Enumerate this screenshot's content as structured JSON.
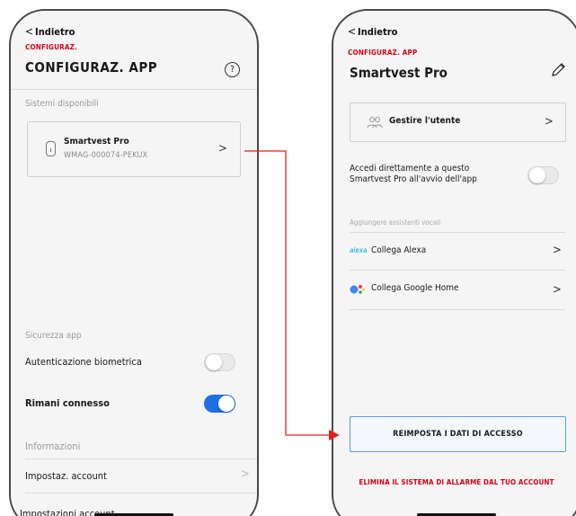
{
  "left": {
    "back": "Indietro",
    "crumb": "CONFIGURAZ.",
    "title": "CONFIGURAZ. APP",
    "help": "?",
    "systems_label": "Sistemi disponibili",
    "system": {
      "name": "Smartvest Pro",
      "code": "WMAG-000074-PEKUX"
    },
    "security_label": "Sicurezza app",
    "biometric": {
      "label": "Autenticazione biometrica",
      "on": false
    },
    "stay_connected": {
      "label": "Rimani connesso",
      "on": true
    },
    "info_label": "Informazioni",
    "account_settings": "Impostaz. account",
    "cut_row": "Impostazioni account"
  },
  "right": {
    "back": "Indietro",
    "crumb": "CONFIGURAZ. APP",
    "title": "Smartvest Pro",
    "manage_user": "Gestire l'utente",
    "direct_access": {
      "label": "Accedi direttamente a questo Smartvest Pro all'avvio dell'app",
      "on": false
    },
    "voice_label": "Aggiungere assistenti vocali",
    "alexa_logo": "alexa",
    "alexa": "Collega Alexa",
    "google": "Collega Google Home",
    "reset": "REIMPOSTA I DATI DI ACCESSO",
    "delete": "ELIMINA IL SISTEMA DI ALLARME DAL TUO ACCOUNT"
  },
  "icons": {
    "back": "chevron-left-icon",
    "help": "question-circle-icon",
    "device": "device-icon",
    "edit": "pencil-icon",
    "users": "users-icon",
    "alexa": "alexa-icon",
    "google": "google-assistant-icon"
  },
  "colors": {
    "accent_red": "#d0021b",
    "toggle_on": "#1f6fe5",
    "reset_border": "#5a9ae6",
    "connector": "#e0201f"
  }
}
